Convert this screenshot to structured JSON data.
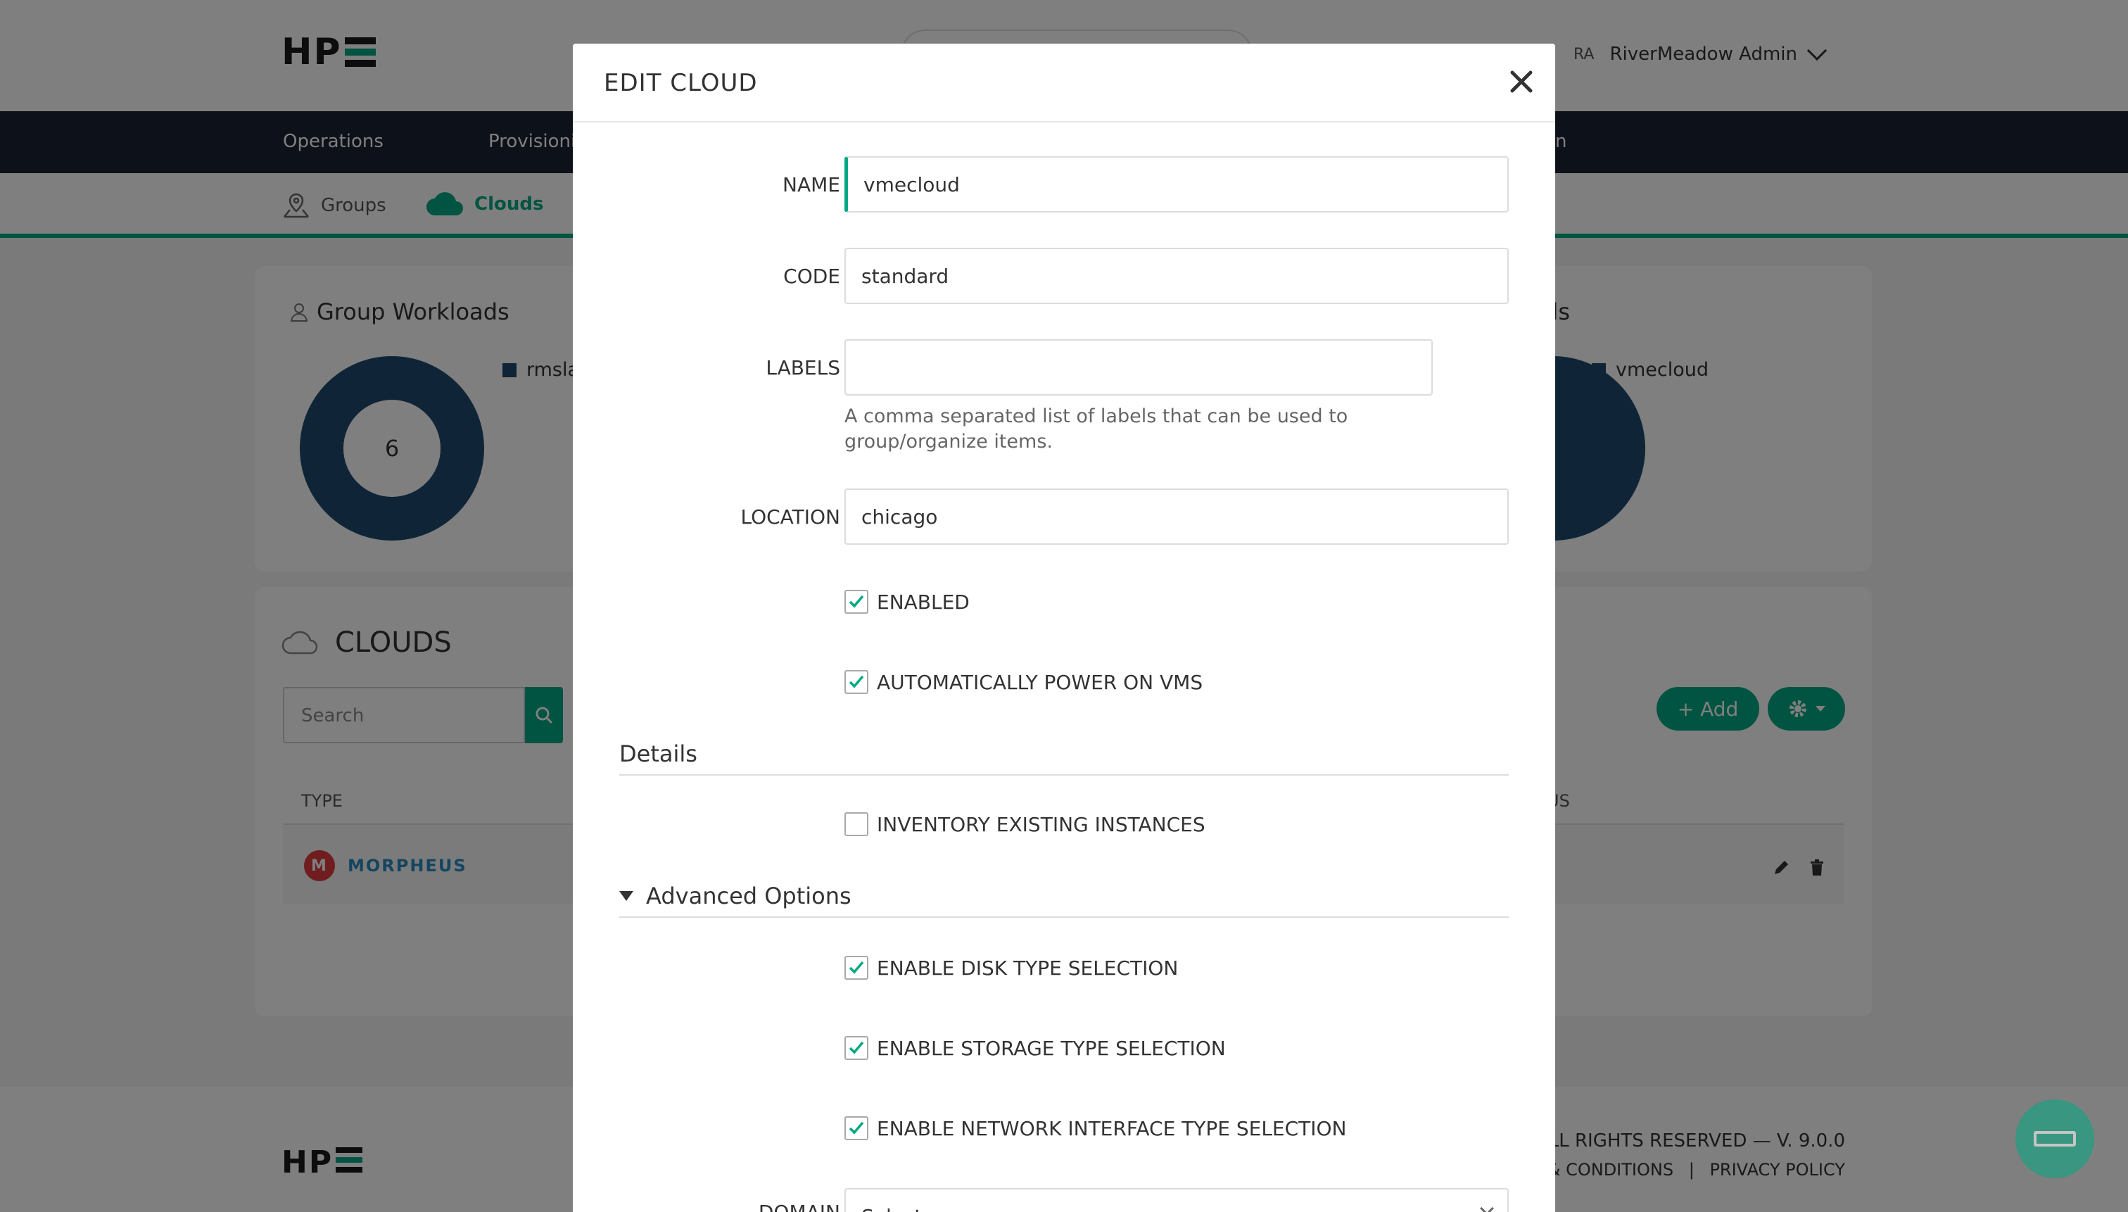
{
  "header": {
    "logo_text": "HP",
    "user_initials": "RA",
    "user_name": "RiverMeadow Admin"
  },
  "nav": {
    "items": [
      "Operations",
      "Provisioni",
      "n"
    ]
  },
  "subnav": {
    "groups": "Groups",
    "clouds": "Clouds"
  },
  "workloads": {
    "group_title": "Group Workloads",
    "group_count": "6",
    "group_legend": "rmsla",
    "cloud_title_fragment": "ds",
    "cloud_legend": "vmecloud"
  },
  "clouds_list": {
    "title": "CLOUDS",
    "search_placeholder": "Search",
    "col_type": "TYPE",
    "col_status_fragment": "US",
    "row_type": "MORPHEUS",
    "add_label": "+ Add"
  },
  "footer": {
    "logo_text": "HP",
    "rights": "ALL RIGHTS RESERVED  — V. 9.0.0",
    "terms": "& CONDITIONS",
    "divider": "|",
    "privacy": "PRIVACY POLICY"
  },
  "modal": {
    "title": "EDIT CLOUD",
    "fields": {
      "name_label": "NAME",
      "name_value": "vmecloud",
      "code_label": "CODE",
      "code_value": "standard",
      "labels_label": "LABELS",
      "labels_value": "",
      "labels_help": "A comma separated list of labels that can be used to group/organize items.",
      "location_label": "LOCATION",
      "location_value": "chicago",
      "domain_label": "DOMAIN",
      "domain_value": "Select"
    },
    "checks": {
      "enabled": "ENABLED",
      "auto_power": "AUTOMATICALLY POWER ON VMS",
      "inventory": "INVENTORY EXISTING INSTANCES",
      "disk_type": "ENABLE DISK TYPE SELECTION",
      "storage_type": "ENABLE STORAGE TYPE SELECTION",
      "network_type": "ENABLE NETWORK INTERFACE TYPE SELECTION"
    },
    "check_states": {
      "enabled": true,
      "auto_power": true,
      "inventory": false,
      "disk_type": true,
      "storage_type": true,
      "network_type": true
    },
    "sections": {
      "details": "Details",
      "advanced": "Advanced Options"
    }
  },
  "colors": {
    "accent": "#01a982",
    "navbar": "#1a2232",
    "donut": "#1e4a6e"
  }
}
